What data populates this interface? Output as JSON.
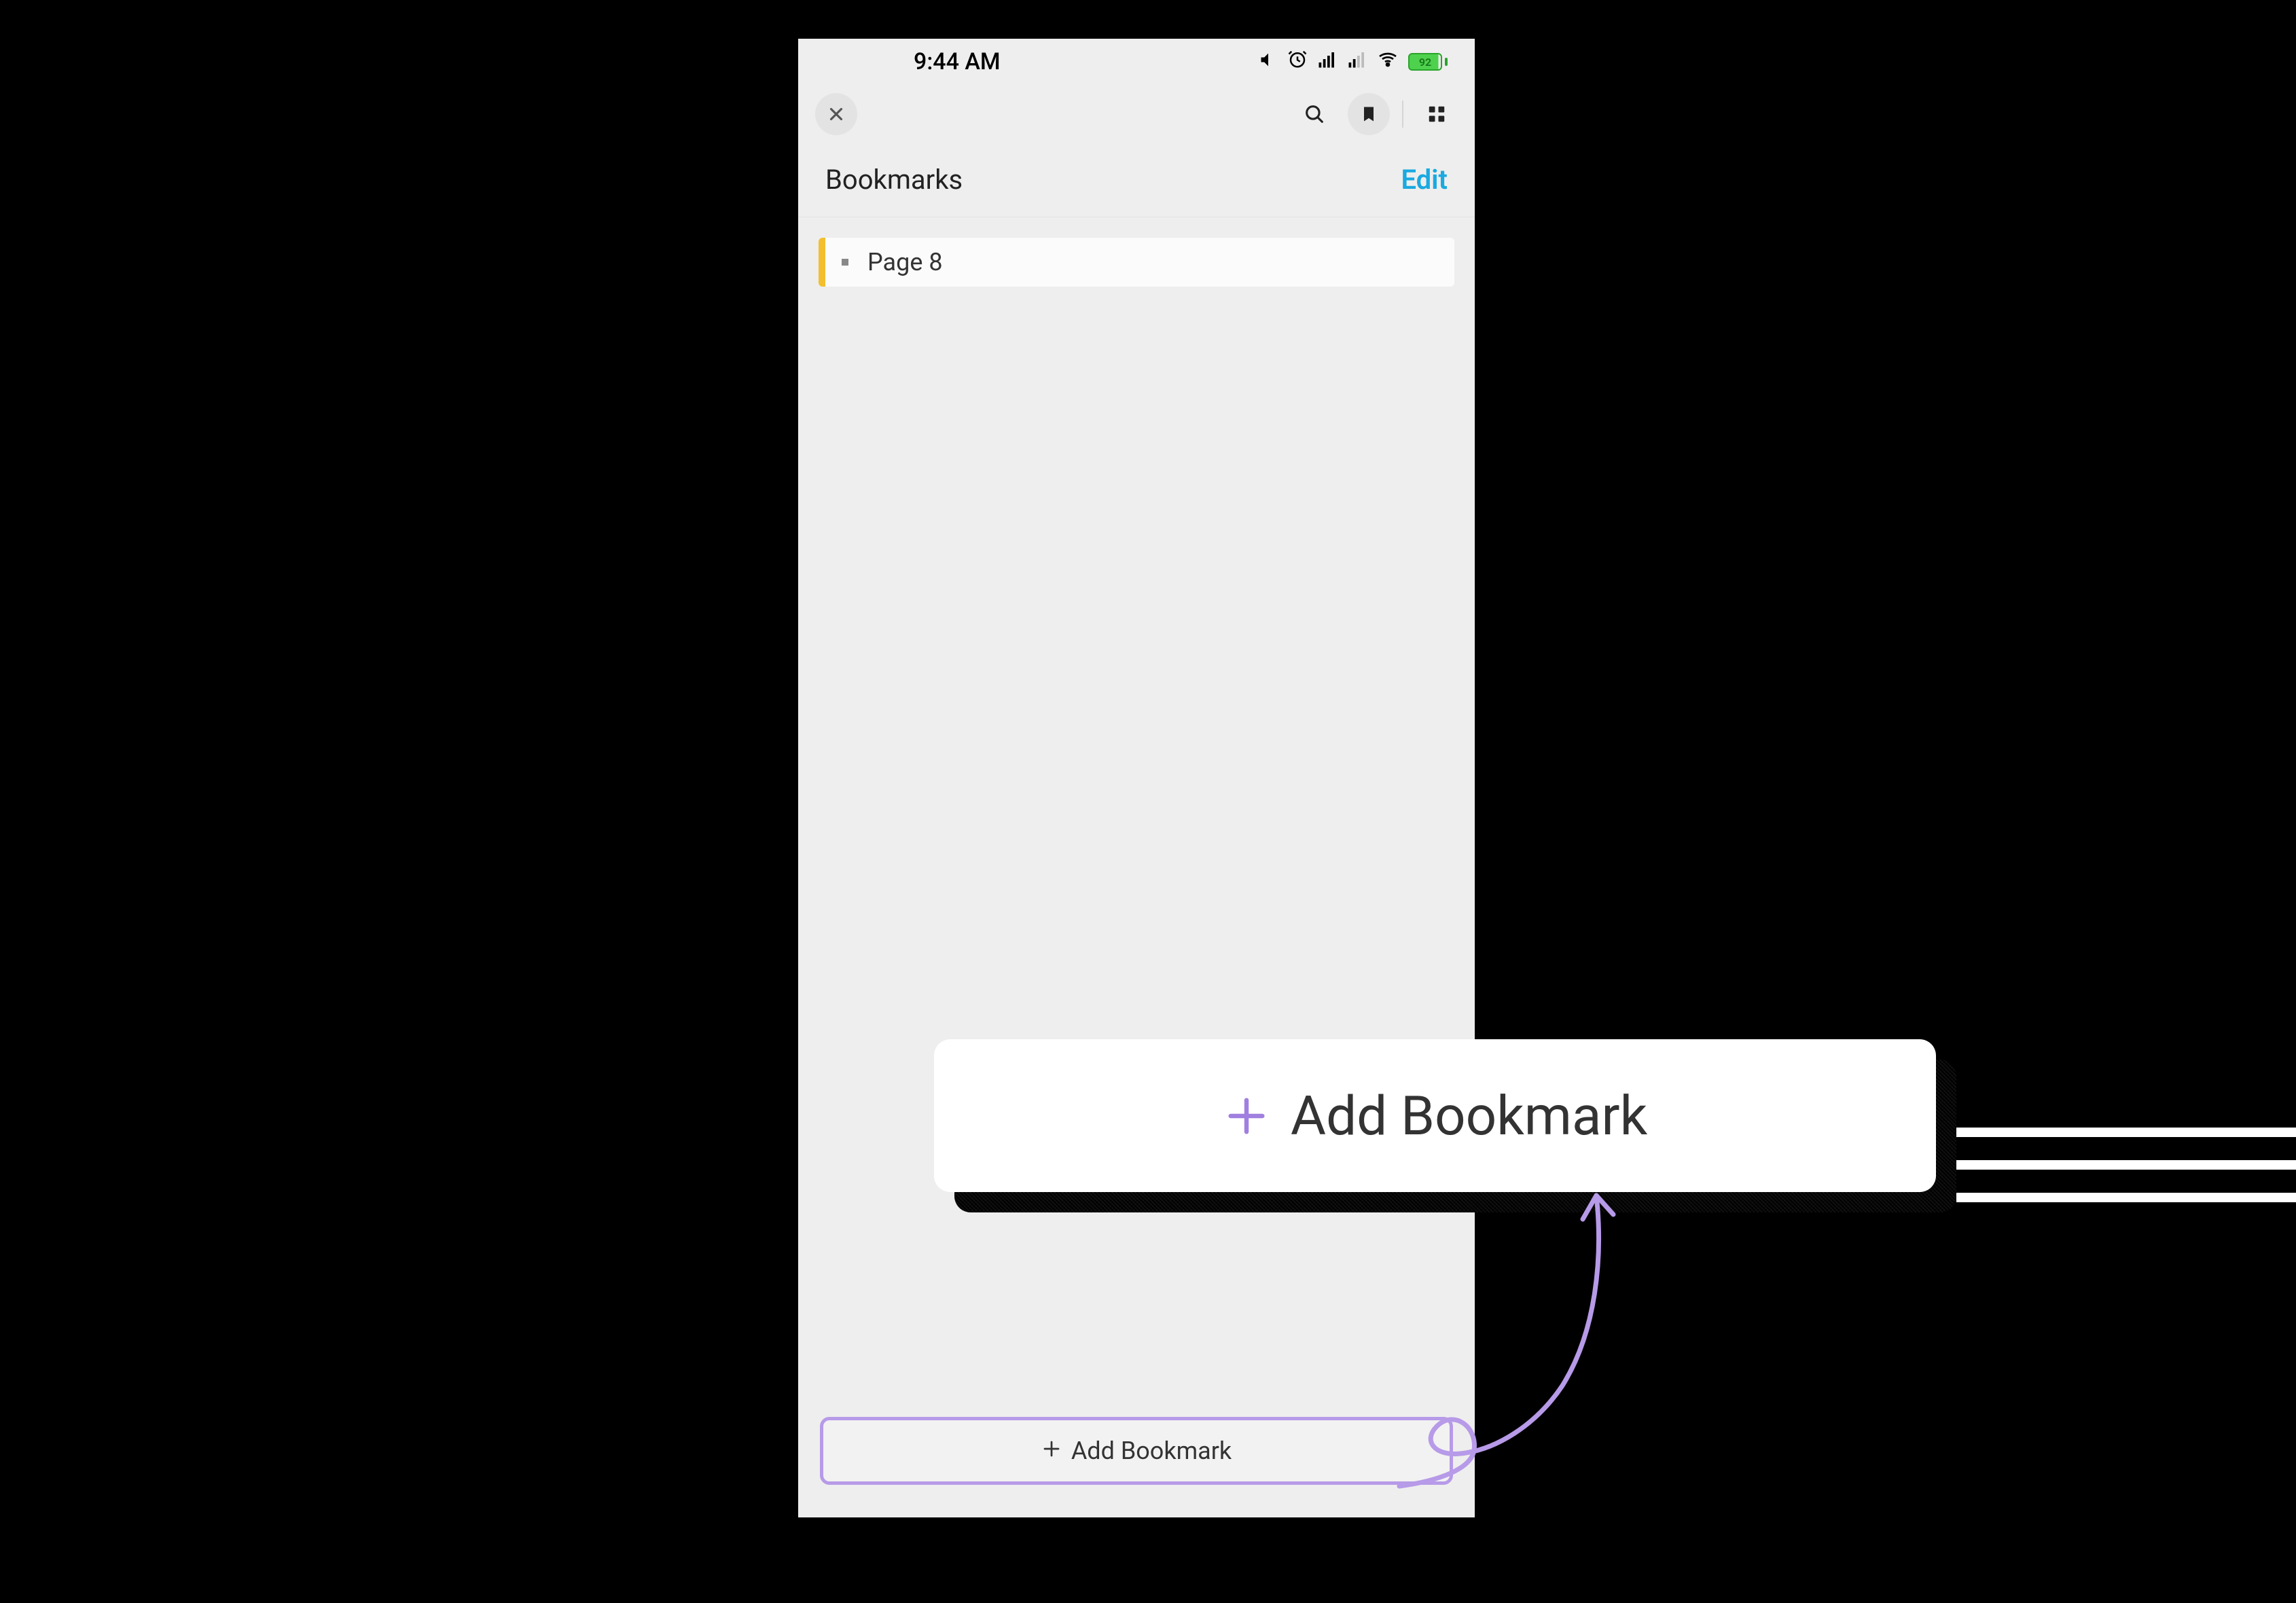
{
  "status": {
    "time": "9:44 AM",
    "battery_pct": "92"
  },
  "header": {
    "title": "Bookmarks",
    "edit_label": "Edit"
  },
  "bookmarks": {
    "item0_label": "Page 8"
  },
  "add_button": {
    "label": "Add Bookmark"
  },
  "callout": {
    "label": "Add Bookmark"
  },
  "colors": {
    "accent_purple": "#a07fe0",
    "highlight_border": "#b79ae8",
    "edit_blue": "#1aa9e0",
    "stripe_yellow": "#f3bf2f"
  }
}
